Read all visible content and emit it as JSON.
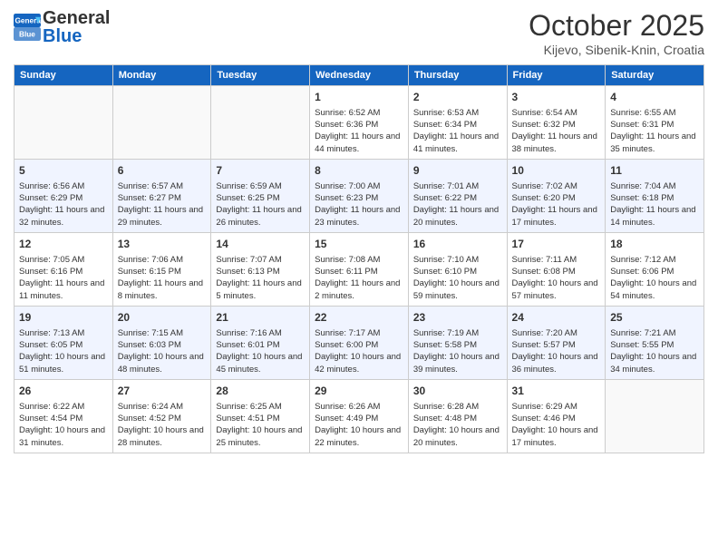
{
  "header": {
    "logo_general": "General",
    "logo_blue": "Blue",
    "month_title": "October 2025",
    "location": "Kijevo, Sibenik-Knin, Croatia"
  },
  "weekdays": [
    "Sunday",
    "Monday",
    "Tuesday",
    "Wednesday",
    "Thursday",
    "Friday",
    "Saturday"
  ],
  "weeks": [
    [
      {
        "day": "",
        "info": ""
      },
      {
        "day": "",
        "info": ""
      },
      {
        "day": "",
        "info": ""
      },
      {
        "day": "1",
        "info": "Sunrise: 6:52 AM\nSunset: 6:36 PM\nDaylight: 11 hours and 44 minutes."
      },
      {
        "day": "2",
        "info": "Sunrise: 6:53 AM\nSunset: 6:34 PM\nDaylight: 11 hours and 41 minutes."
      },
      {
        "day": "3",
        "info": "Sunrise: 6:54 AM\nSunset: 6:32 PM\nDaylight: 11 hours and 38 minutes."
      },
      {
        "day": "4",
        "info": "Sunrise: 6:55 AM\nSunset: 6:31 PM\nDaylight: 11 hours and 35 minutes."
      }
    ],
    [
      {
        "day": "5",
        "info": "Sunrise: 6:56 AM\nSunset: 6:29 PM\nDaylight: 11 hours and 32 minutes."
      },
      {
        "day": "6",
        "info": "Sunrise: 6:57 AM\nSunset: 6:27 PM\nDaylight: 11 hours and 29 minutes."
      },
      {
        "day": "7",
        "info": "Sunrise: 6:59 AM\nSunset: 6:25 PM\nDaylight: 11 hours and 26 minutes."
      },
      {
        "day": "8",
        "info": "Sunrise: 7:00 AM\nSunset: 6:23 PM\nDaylight: 11 hours and 23 minutes."
      },
      {
        "day": "9",
        "info": "Sunrise: 7:01 AM\nSunset: 6:22 PM\nDaylight: 11 hours and 20 minutes."
      },
      {
        "day": "10",
        "info": "Sunrise: 7:02 AM\nSunset: 6:20 PM\nDaylight: 11 hours and 17 minutes."
      },
      {
        "day": "11",
        "info": "Sunrise: 7:04 AM\nSunset: 6:18 PM\nDaylight: 11 hours and 14 minutes."
      }
    ],
    [
      {
        "day": "12",
        "info": "Sunrise: 7:05 AM\nSunset: 6:16 PM\nDaylight: 11 hours and 11 minutes."
      },
      {
        "day": "13",
        "info": "Sunrise: 7:06 AM\nSunset: 6:15 PM\nDaylight: 11 hours and 8 minutes."
      },
      {
        "day": "14",
        "info": "Sunrise: 7:07 AM\nSunset: 6:13 PM\nDaylight: 11 hours and 5 minutes."
      },
      {
        "day": "15",
        "info": "Sunrise: 7:08 AM\nSunset: 6:11 PM\nDaylight: 11 hours and 2 minutes."
      },
      {
        "day": "16",
        "info": "Sunrise: 7:10 AM\nSunset: 6:10 PM\nDaylight: 10 hours and 59 minutes."
      },
      {
        "day": "17",
        "info": "Sunrise: 7:11 AM\nSunset: 6:08 PM\nDaylight: 10 hours and 57 minutes."
      },
      {
        "day": "18",
        "info": "Sunrise: 7:12 AM\nSunset: 6:06 PM\nDaylight: 10 hours and 54 minutes."
      }
    ],
    [
      {
        "day": "19",
        "info": "Sunrise: 7:13 AM\nSunset: 6:05 PM\nDaylight: 10 hours and 51 minutes."
      },
      {
        "day": "20",
        "info": "Sunrise: 7:15 AM\nSunset: 6:03 PM\nDaylight: 10 hours and 48 minutes."
      },
      {
        "day": "21",
        "info": "Sunrise: 7:16 AM\nSunset: 6:01 PM\nDaylight: 10 hours and 45 minutes."
      },
      {
        "day": "22",
        "info": "Sunrise: 7:17 AM\nSunset: 6:00 PM\nDaylight: 10 hours and 42 minutes."
      },
      {
        "day": "23",
        "info": "Sunrise: 7:19 AM\nSunset: 5:58 PM\nDaylight: 10 hours and 39 minutes."
      },
      {
        "day": "24",
        "info": "Sunrise: 7:20 AM\nSunset: 5:57 PM\nDaylight: 10 hours and 36 minutes."
      },
      {
        "day": "25",
        "info": "Sunrise: 7:21 AM\nSunset: 5:55 PM\nDaylight: 10 hours and 34 minutes."
      }
    ],
    [
      {
        "day": "26",
        "info": "Sunrise: 6:22 AM\nSunset: 4:54 PM\nDaylight: 10 hours and 31 minutes."
      },
      {
        "day": "27",
        "info": "Sunrise: 6:24 AM\nSunset: 4:52 PM\nDaylight: 10 hours and 28 minutes."
      },
      {
        "day": "28",
        "info": "Sunrise: 6:25 AM\nSunset: 4:51 PM\nDaylight: 10 hours and 25 minutes."
      },
      {
        "day": "29",
        "info": "Sunrise: 6:26 AM\nSunset: 4:49 PM\nDaylight: 10 hours and 22 minutes."
      },
      {
        "day": "30",
        "info": "Sunrise: 6:28 AM\nSunset: 4:48 PM\nDaylight: 10 hours and 20 minutes."
      },
      {
        "day": "31",
        "info": "Sunrise: 6:29 AM\nSunset: 4:46 PM\nDaylight: 10 hours and 17 minutes."
      },
      {
        "day": "",
        "info": ""
      }
    ]
  ]
}
